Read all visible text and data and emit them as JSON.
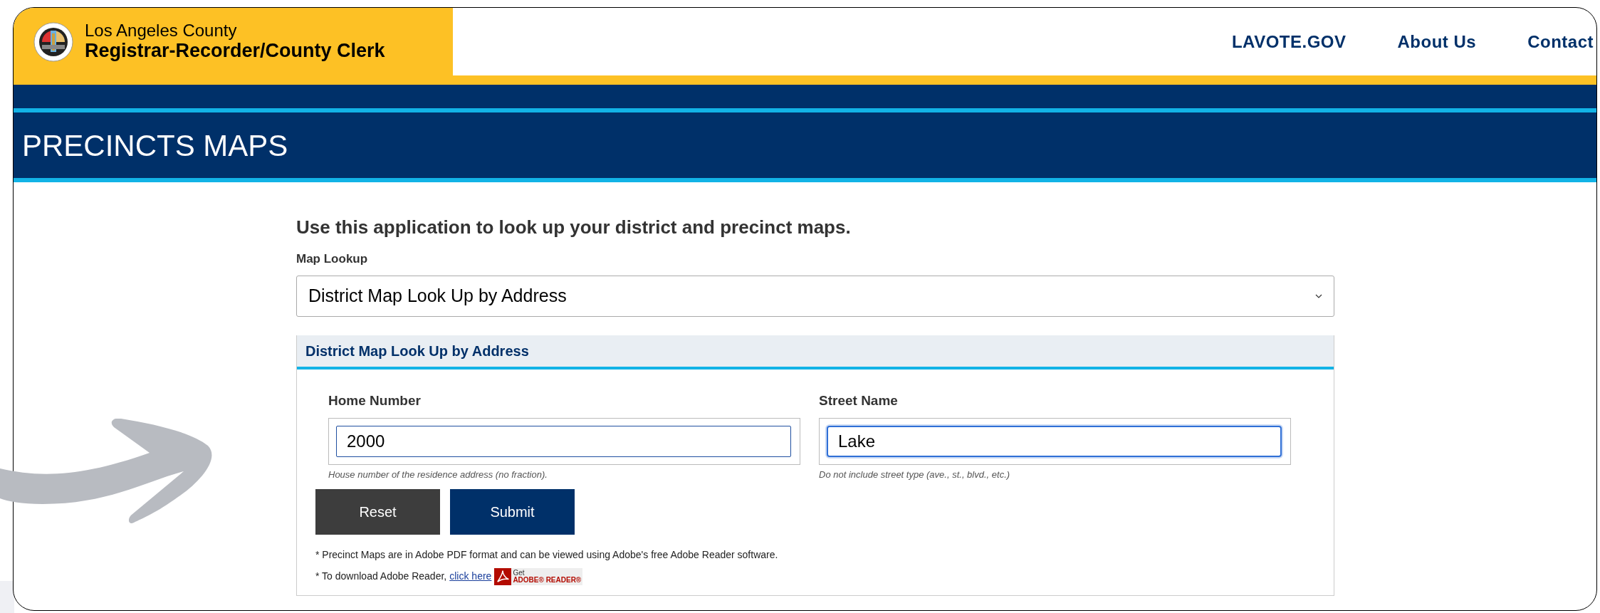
{
  "header": {
    "agency_line1": "Los Angeles County",
    "agency_line2": "Registrar-Recorder/County Clerk",
    "nav": [
      "LAVOTE.GOV",
      "About Us",
      "Contact"
    ]
  },
  "page_title": "PRECINCTS MAPS",
  "intro": "Use this application to look up your district and precinct maps.",
  "map_lookup": {
    "label": "Map Lookup",
    "value": "District Map Look Up by Address"
  },
  "panel": {
    "title": "District Map Look Up by Address",
    "fields": [
      {
        "label": "Home Number",
        "value": "2000",
        "hint": "House number of the residence address (no fraction).",
        "focused": false
      },
      {
        "label": "Street Name",
        "value": "Lake",
        "hint": "Do not include street type (ave., st., blvd., etc.)",
        "focused": true
      }
    ],
    "buttons": [
      {
        "label": "Reset",
        "kind": "secondary"
      },
      {
        "label": "Submit",
        "kind": "primary"
      }
    ],
    "notes": [
      "* Precinct Maps are in Adobe PDF format and can be viewed using Adobe's free Adobe Reader software."
    ],
    "download_note": {
      "text": "* To download Adobe Reader,",
      "link": "click here",
      "badge_line1": "Get",
      "badge_line2": "ADOBE® READER®"
    }
  }
}
